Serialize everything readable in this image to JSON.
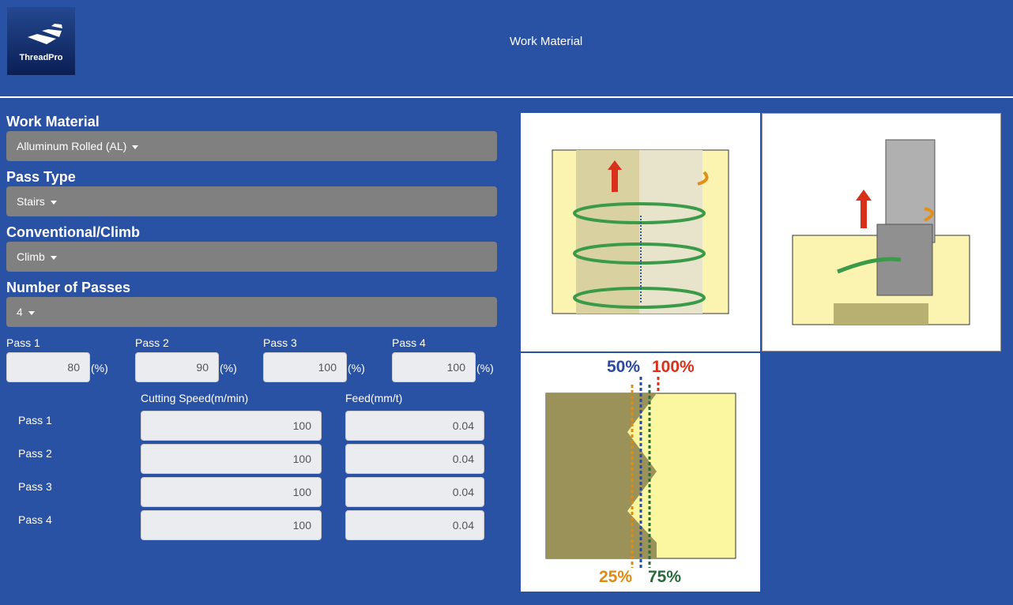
{
  "header": {
    "title": "Work Material",
    "logo_text": "ThreadPro"
  },
  "form": {
    "work_material": {
      "label": "Work Material",
      "value": "Alluminum Rolled (AL)"
    },
    "pass_type": {
      "label": "Pass Type",
      "value": "Stairs"
    },
    "conv_climb": {
      "label": "Conventional/Climb",
      "value": "Climb"
    },
    "num_passes": {
      "label": "Number of Passes",
      "value": "4"
    },
    "pass_depths": [
      {
        "label": "Pass 1",
        "value": "80",
        "unit": "(%)"
      },
      {
        "label": "Pass 2",
        "value": "90",
        "unit": "(%)"
      },
      {
        "label": "Pass 3",
        "value": "100",
        "unit": "(%)"
      },
      {
        "label": "Pass 4",
        "value": "100",
        "unit": "(%)"
      }
    ],
    "speed_header": "Cutting Speed(m/min)",
    "feed_header": "Feed(mm/t)",
    "rows": [
      {
        "label": "Pass 1",
        "speed": "100",
        "feed": "0.04"
      },
      {
        "label": "Pass 2",
        "speed": "100",
        "feed": "0.04"
      },
      {
        "label": "Pass 3",
        "speed": "100",
        "feed": "0.04"
      },
      {
        "label": "Pass 4",
        "speed": "100",
        "feed": "0.04"
      }
    ]
  },
  "diagram": {
    "p50": "50%",
    "p100": "100%",
    "p25": "25%",
    "p75": "75%"
  }
}
